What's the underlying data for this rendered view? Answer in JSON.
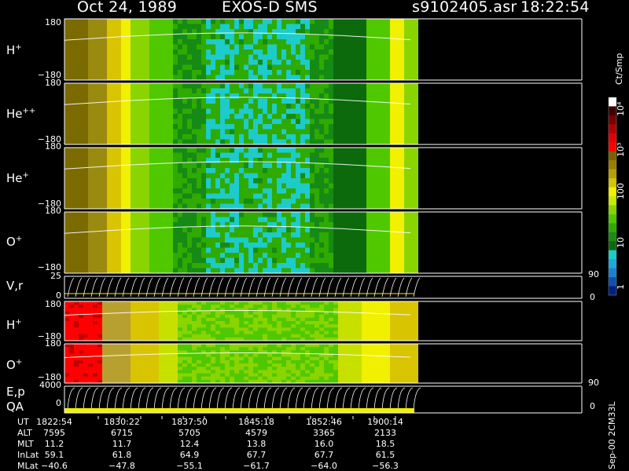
{
  "header": {
    "date": "Oct 24, 1989",
    "instrument": "EXOS-D SMS",
    "filename": "s9102405.asr",
    "time": "18:22:54"
  },
  "colorbar": {
    "title": "Ct/Smp",
    "labels": [
      "10⁴",
      "10³",
      "100",
      "10",
      "1"
    ],
    "colors": [
      "#ffffff",
      "#400000",
      "#7a0000",
      "#b00000",
      "#e00000",
      "#ff0000",
      "#7a6200",
      "#9a7e00",
      "#b8a000",
      "#d2c400",
      "#f0f000",
      "#c8ec00",
      "#8ad400",
      "#50c800",
      "#2faa00",
      "#1e8a14",
      "#0c6a0c",
      "#1ecbcb",
      "#1ea8e0",
      "#1e80d0",
      "#1050b0",
      "#002080"
    ]
  },
  "footer": {
    "vertical_text": "Sep-00 2CM33L"
  },
  "chart_data": {
    "type": "heatmap",
    "panels": [
      {
        "id": "h-plus",
        "label": "H",
        "sup": "+",
        "y_ticks": [
          "180",
          "−180"
        ],
        "ylim": [
          -180,
          180
        ],
        "extent_end": "1900:14"
      },
      {
        "id": "he-plus-plus",
        "label": "He",
        "sup": "++",
        "y_ticks": [
          "180",
          "−180"
        ],
        "ylim": [
          -180,
          180
        ]
      },
      {
        "id": "he-plus",
        "label": "He",
        "sup": "+",
        "y_ticks": [
          "180",
          "−180"
        ],
        "ylim": [
          -180,
          180
        ]
      },
      {
        "id": "o-plus",
        "label": "O",
        "sup": "+",
        "y_ticks": [
          "180",
          "−180"
        ],
        "ylim": [
          -180,
          180
        ]
      },
      {
        "id": "vr",
        "label": "V,r",
        "y_ticks": [
          "25",
          "0"
        ],
        "right_ticks": [
          "90",
          "0"
        ]
      },
      {
        "id": "h-plus-2",
        "label": "H",
        "sup": "+",
        "y_ticks": [
          "180",
          "−180"
        ],
        "ylim": [
          -180,
          180
        ]
      },
      {
        "id": "o-plus-2",
        "label": "O",
        "sup": "+",
        "y_ticks": [
          "180",
          "−180"
        ],
        "ylim": [
          -180,
          180
        ]
      },
      {
        "id": "ep-qa",
        "label": "E,p",
        "label2": "QA",
        "y_ticks": [
          "4000",
          "0"
        ],
        "right_ticks": [
          "90",
          "0"
        ]
      }
    ],
    "ephemeris": {
      "rows": [
        {
          "name": "UT",
          "values": [
            "1822:54",
            "1830:22",
            "1837:50",
            "1845:18",
            "1852:46",
            "1900:14"
          ]
        },
        {
          "name": "ALT",
          "values": [
            "7595",
            "6715",
            "5705",
            "4579",
            "3365",
            "2133"
          ]
        },
        {
          "name": "MLT",
          "values": [
            "11.2",
            "11.7",
            "12.4",
            "13.8",
            "16.0",
            "18.5"
          ]
        },
        {
          "name": "InLat",
          "values": [
            "59.1",
            "61.8",
            "64.9",
            "67.7",
            "67.7",
            "61.5"
          ]
        },
        {
          "name": "MLat",
          "values": [
            "−40.6",
            "−47.8",
            "−55.1",
            "−61.7",
            "−64.0",
            "−56.3"
          ]
        }
      ]
    }
  }
}
